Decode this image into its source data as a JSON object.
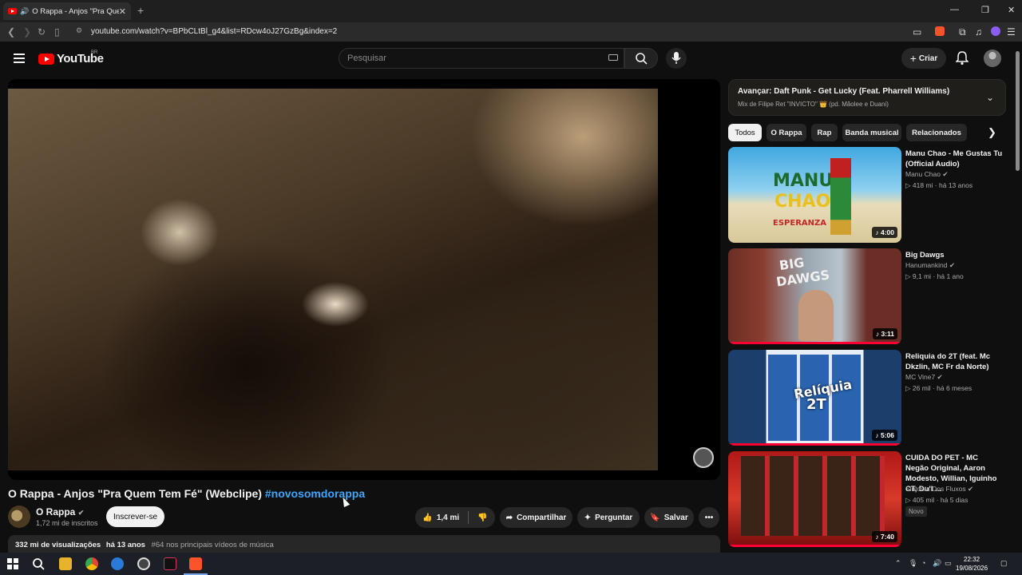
{
  "browser": {
    "tab_title": "O Rappa - Anjos \"Pra Quem",
    "tab_audio_icon": "speaker-icon",
    "url": "youtube.com/watch?v=BPbCLtBl_g4&list=RDcw4oJ27GzBg&index=2"
  },
  "header": {
    "logo_text": "YouTube",
    "logo_region": "BR",
    "search_placeholder": "Pesquisar",
    "create_label": "Criar"
  },
  "video": {
    "title": "O Rappa - Anjos \"Pra Quem Tem Fé\" (Webclipe)",
    "hashtag": "#novosomdorappa",
    "channel_name": "O Rappa",
    "subscribers": "1,72 mi de inscritos",
    "subscribe_label": "Inscrever-se",
    "likes": "1,4 mi",
    "share_label": "Compartilhar",
    "ask_label": "Perguntar",
    "save_label": "Salvar",
    "views": "332 mi de visualizações",
    "age": "há 13 anos",
    "ranking": "#64 nos principais vídeos de música"
  },
  "up_next": {
    "prefix": "Avançar:",
    "title": "Daft Punk - Get Lucky (Feat. Pharrell Williams)",
    "subtitle": "Mix de Filipe Ret \"INVICTO\" 👑 (pd. Mãolee e Duani)"
  },
  "chips": [
    "Todos",
    "O Rappa",
    "Rap",
    "Banda musical",
    "Relacionados"
  ],
  "recommendations": [
    {
      "title": "Manu Chao - Me Gustas Tu (Official Audio)",
      "channel": "Manu Chao",
      "views": "418 mi",
      "age": "há 13 anos",
      "duration": "4:00",
      "thumb_text_1": "MANU",
      "thumb_text_2": "CHAO",
      "thumb_text_3": "ESPERANZA"
    },
    {
      "title": "Big Dawgs",
      "channel": "Hanumankind",
      "views": "9,1 mi",
      "age": "há 1 ano",
      "duration": "3:11",
      "thumb_text_1": "BIG",
      "thumb_text_2": "DAWGS"
    },
    {
      "title": "Reliquia do 2T (feat. Mc Dkzlin, MC Fr da Norte)",
      "channel": "MC Vine7",
      "views": "26 mil",
      "age": "há 6 meses",
      "duration": "5:06",
      "thumb_text_1": "Relíquia",
      "thumb_text_2": "2T"
    },
    {
      "title": "CUIDA DO PET - MC Negão Original, Aaron Modesto, Willian, Iguinho CT, Du'l ...",
      "channel": "Sintonia Dos Fluxos",
      "views": "405 mil",
      "age": "há 5 dias",
      "duration": "7:40",
      "badge": "Novo"
    }
  ],
  "taskbar": {
    "time": "22:32",
    "date": "19/08/2026"
  },
  "colors": {
    "accent_red": "#ff0000",
    "link_blue": "#3ea6ff",
    "background": "#0f0f0f"
  }
}
